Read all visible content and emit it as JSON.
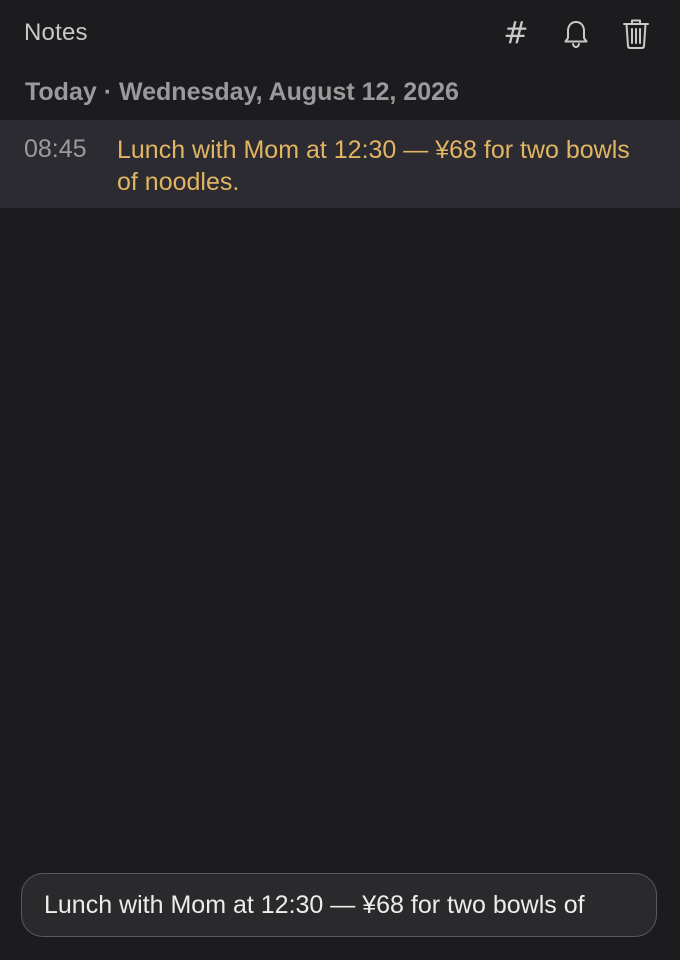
{
  "header": {
    "title": "Notes",
    "icons": {
      "tag": "hash-icon",
      "reminder": "bell-icon",
      "delete": "trash-icon"
    },
    "hash_glyph": "#"
  },
  "day": {
    "label": "Today · Wednesday, August 12, 2026"
  },
  "entries": [
    {
      "time": "08:45",
      "text": "Lunch with Mom at 12:30 — ¥68 for two bowls of noodles."
    }
  ],
  "composer": {
    "value": "Lunch with Mom at 12:30 — ¥68 for two bowls of"
  },
  "colors": {
    "background": "#1c1c1e",
    "entry_highlight": "#2b2b31",
    "entry_text": "#e2b563",
    "muted_text": "#9a9a9c"
  }
}
